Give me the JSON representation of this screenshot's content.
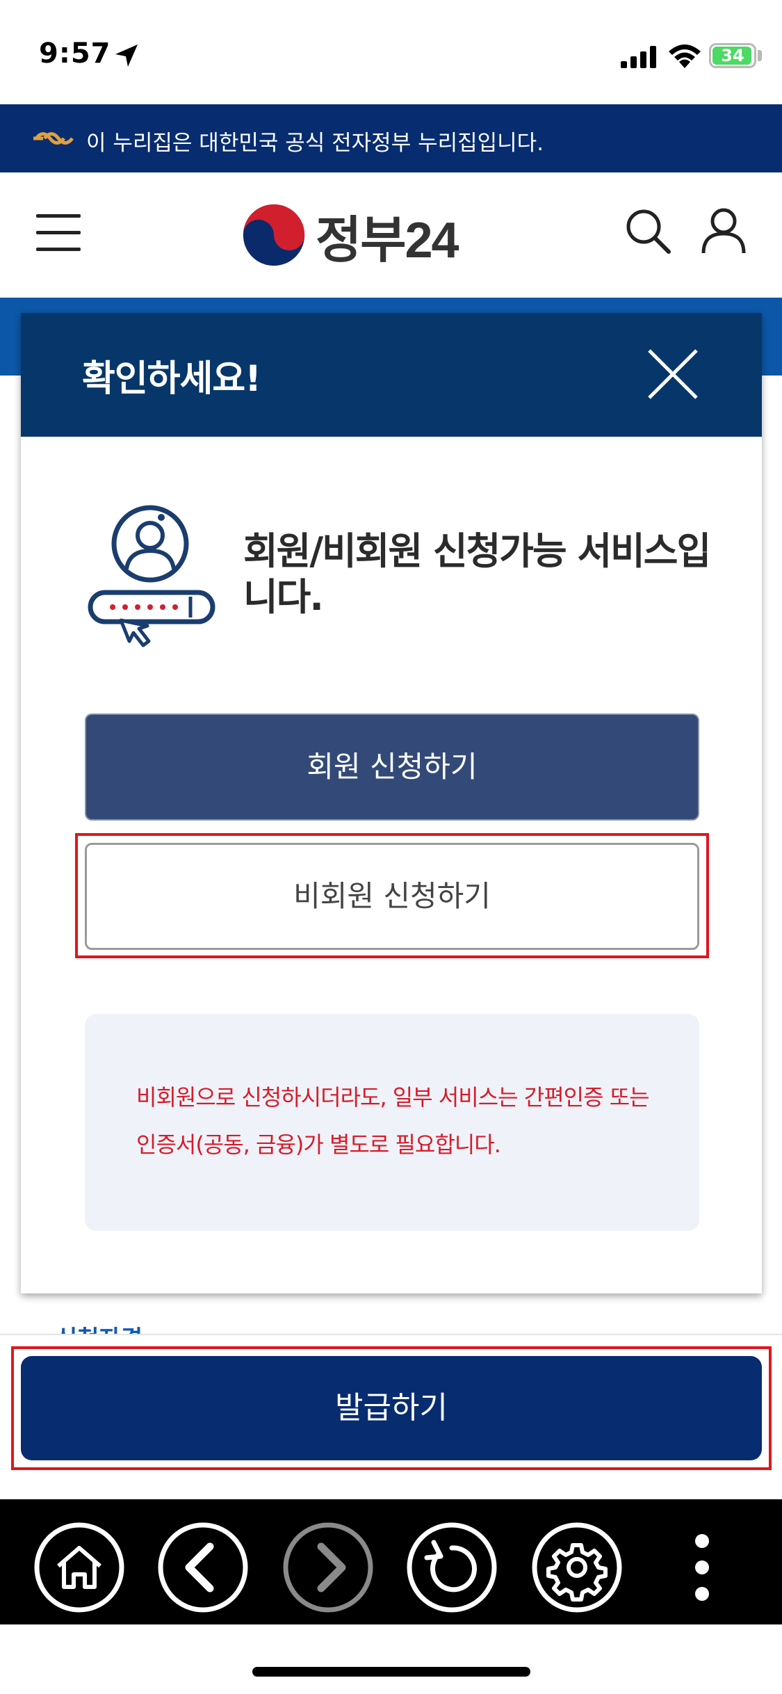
{
  "status_bar": {
    "time": "9:57",
    "battery": "34"
  },
  "gov_banner": {
    "text": "이 누리집은 대한민국 공식 전자정부 누리집입니다."
  },
  "header": {
    "logo_text": "정부24"
  },
  "page": {
    "peek_text": "신청자격"
  },
  "modal": {
    "title": "확인하세요!",
    "headline": "회원/비회원 신청가능 서비스입니다.",
    "member_button": "회원 신청하기",
    "nonmember_button": "비회원 신청하기",
    "notice": "비회원으로 신청하시더라도, 일부 서비스는 간편인증 또는 인증서(공동, 금융)가 별도로 필요합니다."
  },
  "issue_button": {
    "label": "발급하기"
  },
  "toolbar": {
    "icons": [
      "home-icon",
      "back-icon",
      "forward-icon",
      "reload-icon",
      "settings-icon",
      "more-icon"
    ]
  },
  "colors": {
    "gov_navy": "#072c70",
    "modal_header": "#07376a",
    "member_button": "#334a78",
    "notice_red": "#d81b2a",
    "highlight_red": "#e0151d"
  }
}
